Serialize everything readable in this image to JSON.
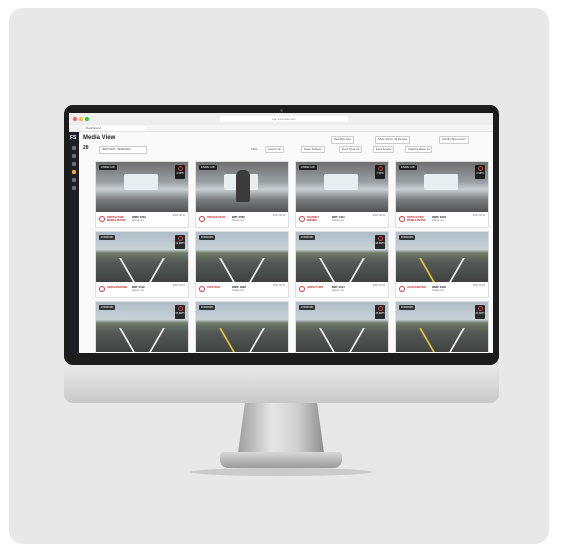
{
  "browser": {
    "url": "app.example.com",
    "tab_title": "Dashboard"
  },
  "app": {
    "logo": "FS",
    "page_title": "Media View",
    "date_badge": "28",
    "date_range": "09/07/2023 - 09/08/2023",
    "header_controls": [
      "New Play Alert",
      "Show: Hours, All Devices",
      "Sort By: Most recent"
    ],
    "filter_label": "Filter:",
    "filters": [
      "Sensors: All",
      "Fleets: All Fleets",
      "Event Types: All",
      "Event Severity",
      "Coaching Status: All"
    ]
  },
  "tiles": [
    {
      "tag": "INSIDE CAB",
      "kind": "cabin",
      "speed": "0 MPH",
      "event": "DISTRACTION: MOBILE PHONE",
      "vehicle": "WMC 2231",
      "location": "Atlanta, GA",
      "time": "09/07 08:10"
    },
    {
      "tag": "INSIDE CAB",
      "kind": "cabin-person",
      "speed": "",
      "event": "OFFICER STAFF",
      "vehicle": "BRT 2525",
      "location": "Atlanta, GA",
      "time": "09/07 08:14"
    },
    {
      "tag": "INSIDE CAB",
      "kind": "cabin",
      "speed": "7 MPH",
      "event": "SEATBELT MISSING",
      "vehicle": "BRT 1421",
      "location": "Atlanta, GA",
      "time": "09/07 08:22"
    },
    {
      "tag": "INSIDE CAB",
      "kind": "cabin",
      "speed": "0 MPH",
      "event": "DISTRACTION: MOBILE PHONE",
      "vehicle": "WMC 3243",
      "location": "Atlanta, GA",
      "time": "09/07 08:31"
    },
    {
      "tag": "FORWARD",
      "kind": "road",
      "speed": "72 MPH",
      "event": "HARSH BRAKING",
      "vehicle": "BRT 3119",
      "location": "Atlanta, GA",
      "time": "09/07 09:02"
    },
    {
      "tag": "FORWARD",
      "kind": "road",
      "speed": "",
      "event": "STOP SIGN",
      "vehicle": "WMC 1822",
      "location": "Atlanta, GA",
      "time": "09/07 09:15"
    },
    {
      "tag": "FORWARD",
      "kind": "road",
      "speed": "45 MPH",
      "event": "HARSH TURN",
      "vehicle": "BRT 3121",
      "location": "Atlanta, GA",
      "time": "09/07 09:40"
    },
    {
      "tag": "FORWARD",
      "kind": "road-yellow",
      "speed": "",
      "event": "ACCELERATION",
      "vehicle": "WMC 3340",
      "location": "Atlanta, GA",
      "time": "09/07 10:05"
    },
    {
      "tag": "FORWARD",
      "kind": "road",
      "speed": "55 MPH",
      "event": "",
      "vehicle": "",
      "location": "",
      "time": ""
    },
    {
      "tag": "FORWARD",
      "kind": "road-yellow",
      "speed": "",
      "event": "",
      "vehicle": "",
      "location": "",
      "time": ""
    },
    {
      "tag": "FORWARD",
      "kind": "road",
      "speed": "35 MPH",
      "event": "",
      "vehicle": "",
      "location": "",
      "time": ""
    },
    {
      "tag": "FORWARD",
      "kind": "road-yellow",
      "speed": "64 MPH",
      "event": "",
      "vehicle": "",
      "location": "",
      "time": ""
    }
  ]
}
